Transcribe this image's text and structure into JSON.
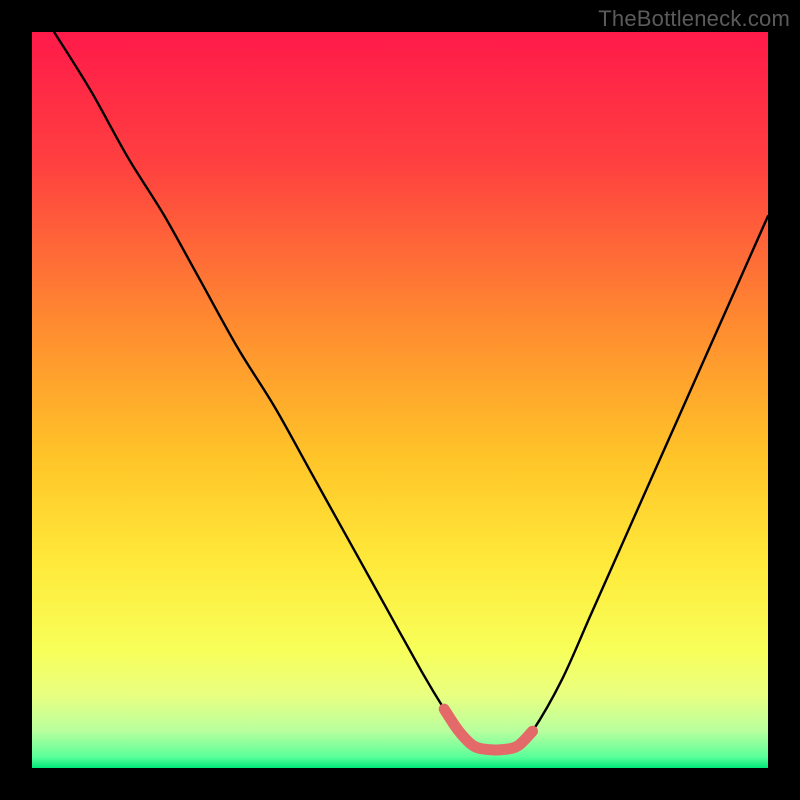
{
  "watermark": "TheBottleneck.com",
  "colors": {
    "frame": "#000000",
    "curve": "#000000",
    "highlight": "#E46A6A",
    "gradient_stops": [
      {
        "pos": 0.0,
        "color": "#FF1A4A"
      },
      {
        "pos": 0.18,
        "color": "#FF4040"
      },
      {
        "pos": 0.4,
        "color": "#FF8C30"
      },
      {
        "pos": 0.58,
        "color": "#FFC528"
      },
      {
        "pos": 0.72,
        "color": "#FFE93A"
      },
      {
        "pos": 0.84,
        "color": "#F7FF59"
      },
      {
        "pos": 0.9,
        "color": "#E9FF80"
      },
      {
        "pos": 0.95,
        "color": "#B8FF9E"
      },
      {
        "pos": 0.985,
        "color": "#5AFF9A"
      },
      {
        "pos": 1.0,
        "color": "#00E878"
      }
    ]
  },
  "chart_data": {
    "type": "line",
    "title": "",
    "xlabel": "",
    "ylabel": "",
    "xlim": [
      0,
      100
    ],
    "ylim": [
      0,
      100
    ],
    "grid": false,
    "legend": false,
    "series": [
      {
        "name": "bottleneck-curve",
        "x": [
          3,
          8,
          13,
          18,
          23,
          28,
          33,
          38,
          43,
          48,
          53,
          56,
          58,
          60,
          62,
          64,
          66,
          68,
          72,
          76,
          80,
          84,
          88,
          92,
          96,
          100
        ],
        "y": [
          100,
          92,
          83,
          75,
          66,
          57,
          49,
          40,
          31,
          22,
          13,
          8,
          5,
          3,
          2.5,
          2.5,
          3,
          5,
          12,
          21,
          30,
          39,
          48,
          57,
          66,
          75
        ]
      }
    ],
    "highlight_segment": {
      "x": [
        56,
        58,
        60,
        62,
        64,
        66,
        68
      ],
      "y": [
        8,
        5,
        3,
        2.5,
        2.5,
        3,
        5
      ]
    }
  }
}
